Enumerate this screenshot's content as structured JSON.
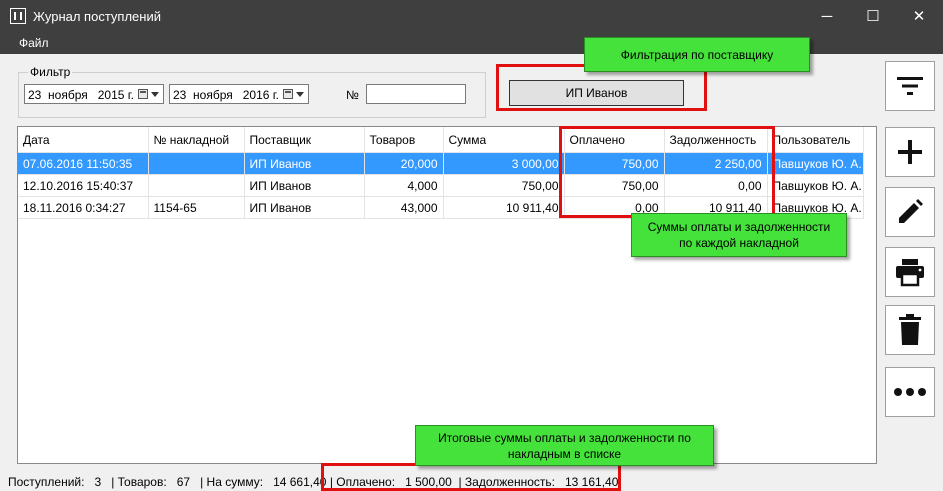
{
  "window": {
    "title": "Журнал поступлений",
    "minimize_glyph": "─",
    "maximize_glyph": "☐",
    "close_glyph": "✕"
  },
  "menu": {
    "items": [
      {
        "label": "Файл"
      }
    ]
  },
  "filter": {
    "legend": "Фильтр",
    "date_from": "23  ноября   2015 г.",
    "date_to": "23  ноября   2016 г.",
    "number_label": "№",
    "number_value": "",
    "supplier_button": "ИП Иванов"
  },
  "grid": {
    "columns": [
      "Дата",
      "№ накладной",
      "Поставщик",
      "Товаров",
      "Сумма",
      "Оплачено",
      "Задолженность",
      "Пользователь"
    ],
    "rows": [
      [
        "07.06.2016 11:50:35",
        "",
        "ИП Иванов",
        "20,000",
        "3 000,00",
        "750,00",
        "2 250,00",
        "Павшуков Ю. А."
      ],
      [
        "12.10.2016 15:40:37",
        "",
        "ИП Иванов",
        "4,000",
        "750,00",
        "750,00",
        "0,00",
        "Павшуков Ю. А."
      ],
      [
        "18.11.2016 0:34:27",
        "1154-65",
        "ИП Иванов",
        "43,000",
        "10 911,40",
        "0,00",
        "10 911,40",
        "Павшуков Ю. А."
      ]
    ],
    "selected_row": 0
  },
  "status": {
    "receipts_label": "Поступлений:",
    "receipts_value": "3",
    "goods_label": "| Товаров:",
    "goods_value": "67",
    "sum_label": "| На сумму:",
    "sum_value": "14 661,40",
    "paid_label": "| Оплачено:",
    "paid_value": "1 500,00",
    "debt_label": "| Задолженность:",
    "debt_value": "13 161,40"
  },
  "sidebar": {
    "buttons": [
      {
        "name": "filter-button",
        "icon": "filter-icon"
      },
      {
        "name": "add-button",
        "icon": "plus-icon"
      },
      {
        "name": "edit-button",
        "icon": "pencil-icon"
      },
      {
        "name": "print-button",
        "icon": "printer-icon"
      },
      {
        "name": "delete-button",
        "icon": "trash-icon"
      },
      {
        "name": "more-button",
        "icon": "more-icon"
      }
    ]
  },
  "annotations": {
    "supplier_filter": "Фильтрация по поставщику",
    "row_amounts_line1": "Суммы оплаты и задолженности",
    "row_amounts_line2": "по каждой накладной",
    "totals_line1": "Итоговые суммы оплаты и задолженности по",
    "totals_line2": "накладным в списке"
  },
  "colors": {
    "titlebar": "#3f3f3f",
    "selection": "#3399ff",
    "callout": "#45e23c",
    "highlight": "#e01010"
  }
}
